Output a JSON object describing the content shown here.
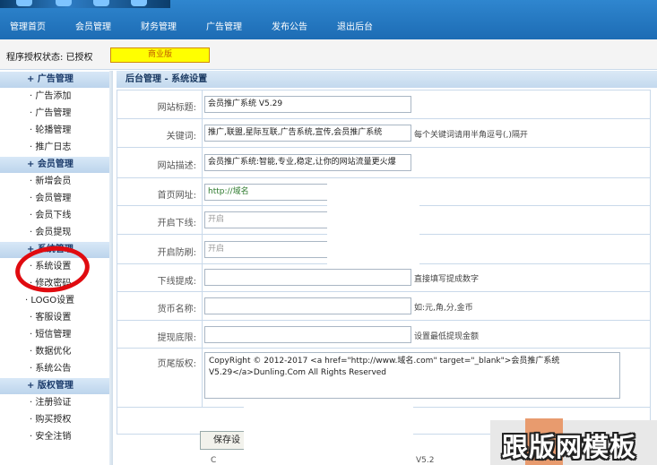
{
  "nav": {
    "items": [
      "管理首页",
      "会员管理",
      "财务管理",
      "广告管理",
      "发布公告",
      "退出后台"
    ]
  },
  "status": {
    "label": "程序授权状态: 已授权",
    "edition": "商业版"
  },
  "sidebar": {
    "groups": [
      {
        "title": "+ 广告管理",
        "items": [
          "· 广告添加",
          "· 广告管理",
          "· 轮播管理",
          "· 推广日志"
        ]
      },
      {
        "title": "+ 会员管理",
        "items": [
          "· 新增会员",
          "· 会员管理",
          "· 会员下线",
          "· 会员提现"
        ]
      },
      {
        "title": "+ 系统管理",
        "items": [
          "· 系统设置",
          "· 修改密码",
          "· LOGO设置",
          "· 客服设置",
          "· 短信管理",
          "· 数据优化",
          "· 系统公告"
        ]
      },
      {
        "title": "+ 版权管理",
        "items": [
          "· 注册验证",
          "· 购买授权",
          "· 安全注销"
        ]
      }
    ]
  },
  "panel": {
    "title": "后台管理 - 系统设置"
  },
  "form": {
    "site_title": {
      "label": "网站标题:",
      "value": "会员推广系统 V5.29"
    },
    "keywords": {
      "label": "关键词:",
      "value": "推广,联盟,星际互联,广告系统,宣传,会员推广系统",
      "note": "每个关键词请用半角逗号(,)隔开"
    },
    "description": {
      "label": "网站描述:",
      "value": "会员推广系统:智能,专业,稳定,让你的网站流量更火爆"
    },
    "home_url": {
      "label": "首页网址:",
      "value": "http://域名"
    },
    "downline": {
      "label": "开启下线:",
      "value": "开启"
    },
    "anti_fraud": {
      "label": "开启防刷:",
      "value": "开启"
    },
    "downline_commission": {
      "label": "下线提成:",
      "value": "",
      "note": "直接填写提成数字"
    },
    "currency": {
      "label": "货币名称:",
      "value": "",
      "note": "如:元,角,分,金币"
    },
    "withdraw_min": {
      "label": "提现底限:",
      "value": "",
      "note": "设置最低提现金额"
    },
    "footer": {
      "label": "页尾版权:",
      "value": "CopyRight © 2012-2017 <a href=\"http://www.域名.com\" target=\"_blank\">会员推广系统 V5.29</a>Dunling.Com All Rights Reserved"
    },
    "save_label": "保存设"
  },
  "watermark": {
    "text": "跟版网模板"
  },
  "footer_fragments": {
    "left": "C",
    "right": "V5.2"
  }
}
